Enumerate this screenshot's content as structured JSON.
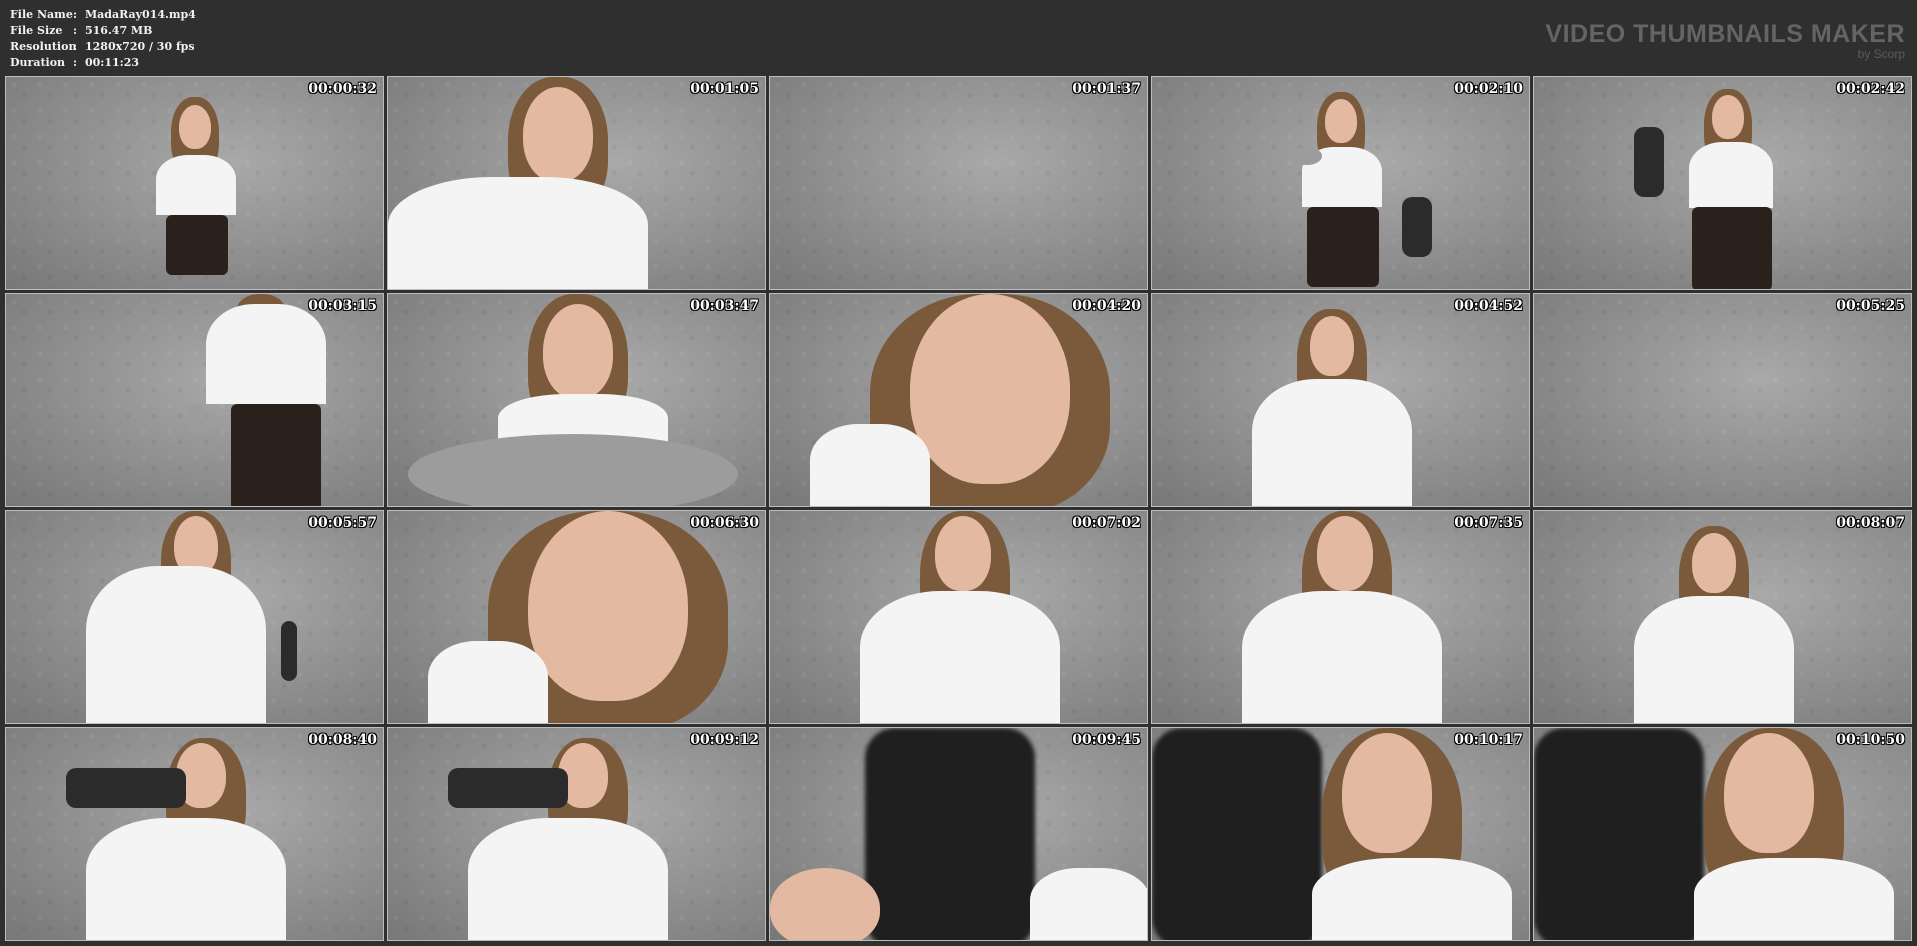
{
  "file_info": {
    "rows": [
      {
        "label": "File Name",
        "sep": ":",
        "value": "MadaRay014.mp4"
      },
      {
        "label": "File Size",
        "sep": ":",
        "value": "516.47 MB"
      },
      {
        "label": "Resolution",
        "sep": ":",
        "value": "1280x720 / 30 fps"
      },
      {
        "label": "Duration",
        "sep": ":",
        "value": "00:11:23"
      }
    ]
  },
  "brand": {
    "title": "VIDEO THUMBNAILS MAKER",
    "subtitle": "by Scorp"
  },
  "thumbnails": [
    {
      "time": "00:00:32",
      "scene": "standing"
    },
    {
      "time": "00:01:05",
      "scene": "leaning-close"
    },
    {
      "time": "00:01:37",
      "scene": "empty-wall"
    },
    {
      "time": "00:02:10",
      "scene": "standing-tape"
    },
    {
      "time": "00:02:42",
      "scene": "standing-harness"
    },
    {
      "time": "00:03:15",
      "scene": "side-tape"
    },
    {
      "time": "00:03:47",
      "scene": "tape-closeup"
    },
    {
      "time": "00:04:20",
      "scene": "face-closeup"
    },
    {
      "time": "00:04:52",
      "scene": "seated"
    },
    {
      "time": "00:05:25",
      "scene": "empty-wall"
    },
    {
      "time": "00:05:57",
      "scene": "arm-raised"
    },
    {
      "time": "00:06:30",
      "scene": "face-closeup"
    },
    {
      "time": "00:07:02",
      "scene": "hand-chin"
    },
    {
      "time": "00:07:35",
      "scene": "hand-chin"
    },
    {
      "time": "00:08:07",
      "scene": "seated"
    },
    {
      "time": "00:08:40",
      "scene": "harness-holding"
    },
    {
      "time": "00:09:12",
      "scene": "harness-holding"
    },
    {
      "time": "00:09:45",
      "scene": "object-closeup"
    },
    {
      "time": "00:10:17",
      "scene": "object-side"
    },
    {
      "time": "00:10:50",
      "scene": "object-side"
    }
  ]
}
